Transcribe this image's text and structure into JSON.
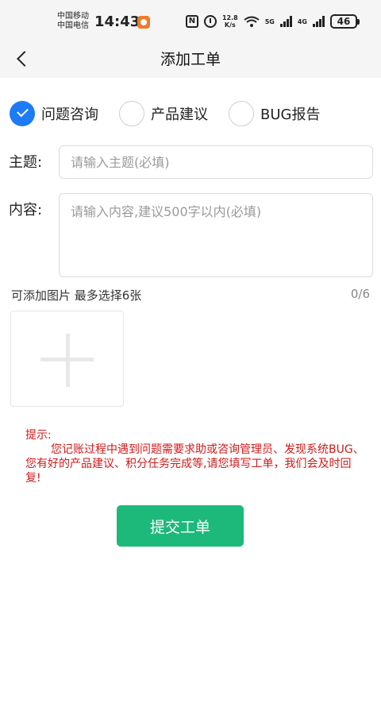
{
  "status_bar": {
    "carrier_line1": "中国移动",
    "carrier_line2": "中国电信",
    "time": "14:43",
    "speed_value": "12.8",
    "speed_unit": "K/s",
    "net1": "5G",
    "net2": "4G",
    "battery": "46"
  },
  "nav": {
    "title": "添加工单"
  },
  "categories": [
    {
      "label": "问题咨询",
      "checked": true
    },
    {
      "label": "产品建议",
      "checked": false
    },
    {
      "label": "BUG报告",
      "checked": false
    }
  ],
  "form": {
    "subject_label": "主题:",
    "subject_placeholder": "请输入主题(必填)",
    "content_label": "内容:",
    "content_placeholder": "请输入内容,建议500字以内(必填)"
  },
  "images": {
    "hint": "可添加图片 最多选择6张",
    "count": "0/6"
  },
  "tip": {
    "title": "提示:",
    "body": "您记账过程中遇到问题需要求助或咨询管理员、发现系统BUG、您有好的产品建议、积分任务完成等,请您填写工单，我们会及时回复!"
  },
  "submit_label": "提交工单",
  "colors": {
    "accent": "#1e7bf6",
    "submit": "#1db97a",
    "tip": "#d11a1a"
  }
}
